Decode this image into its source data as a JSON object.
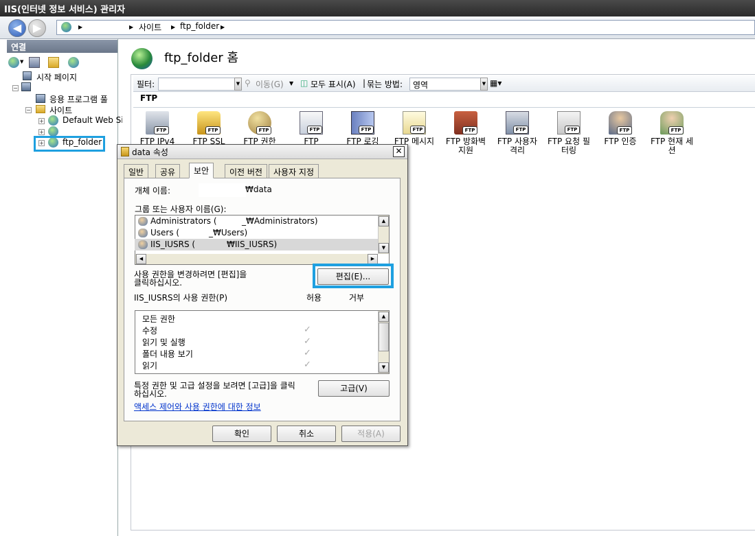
{
  "window": {
    "title": "IIS(인터넷 정보 서비스) 관리자"
  },
  "address": {
    "crumbs": [
      "사이트",
      "ftp_folder"
    ]
  },
  "connections": {
    "header": "연결",
    "tree": [
      {
        "label": "시작 페이지"
      },
      {
        "label": ""
      },
      {
        "label": "응용 프로그램 풀"
      },
      {
        "label": "사이트"
      },
      {
        "label": "Default Web Si"
      },
      {
        "label": ""
      },
      {
        "label": "ftp_folder"
      }
    ]
  },
  "main": {
    "title": "ftp_folder 홈",
    "filter_label": "필터:",
    "go_label": "이동(G)",
    "show_all_label": "모두 표시(A)",
    "group_by_label": "묶는 방법:",
    "group_by_value": "영역",
    "section": "FTP",
    "features": [
      {
        "label": "FTP IPv4"
      },
      {
        "label": "FTP SSL"
      },
      {
        "label": "FTP 권한"
      },
      {
        "label": "FTP"
      },
      {
        "label": "FTP 로깅"
      },
      {
        "label": "FTP 메시지"
      },
      {
        "label": "FTP 방화벽 지원"
      },
      {
        "label": "FTP 사용자 격리"
      },
      {
        "label": "FTP 요청 필터링"
      },
      {
        "label": "FTP 인증"
      },
      {
        "label": "FTP 현재 세션"
      }
    ]
  },
  "dialog": {
    "title": "data 속성",
    "close": "✕",
    "tabs": [
      "일반",
      "공유",
      "보안",
      "이전 버전",
      "사용자 지정"
    ],
    "object_name_label": "개체 이름:",
    "object_name_value": "₩data",
    "group_label": "그룹 또는 사용자 이름(G):",
    "users": [
      {
        "name": "Administrators (",
        "suffix": "_₩Administrators)"
      },
      {
        "name": "Users (",
        "suffix": "_₩Users)"
      },
      {
        "name": "IIS_IUSRS (",
        "suffix": "₩IIS_IUSRS)"
      }
    ],
    "change_text_1": "사용 권한을 변경하려면 [편집]을",
    "change_text_2": "클릭하십시오.",
    "edit_button": "편집(E)...",
    "perm_label": "IIS_IUSRS의 사용 권한(P)",
    "allow_label": "허용",
    "deny_label": "거부",
    "permissions": [
      {
        "name": "모든 권한",
        "allow": ""
      },
      {
        "name": "수정",
        "allow": "✓"
      },
      {
        "name": "읽기 및 실행",
        "allow": "✓"
      },
      {
        "name": "폴더 내용 보기",
        "allow": "✓"
      },
      {
        "name": "읽기",
        "allow": "✓"
      }
    ],
    "advanced_text_1": "특정 권한 및 고급 설정을 보려면 [고급]을 클릭",
    "advanced_text_2": "하십시오.",
    "advanced_button": "고급(V)",
    "info_link": "액세스 제어와 사용 권한에 대한 정보",
    "ok": "확인",
    "cancel": "취소",
    "apply": "적용(A)"
  }
}
